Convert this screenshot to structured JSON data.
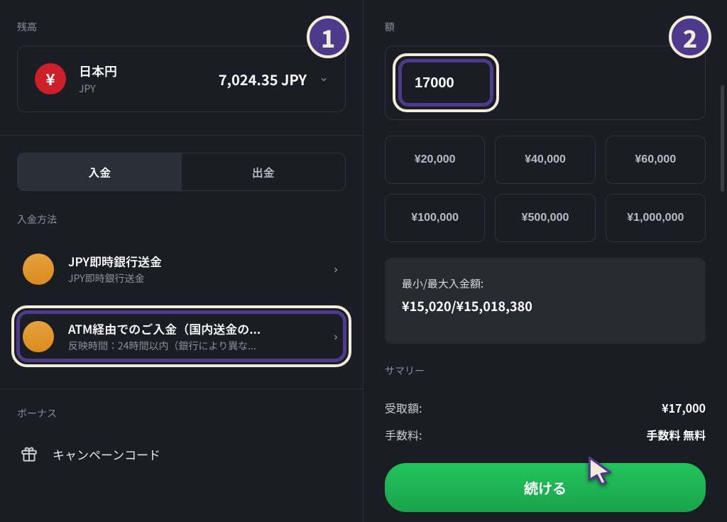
{
  "left": {
    "balance_label": "残高",
    "currency_name": "日本円",
    "currency_code": "JPY",
    "balance_amount": "7,024.35 JPY",
    "tabs": {
      "deposit": "入金",
      "withdraw": "出金"
    },
    "method_label": "入金方法",
    "methods": [
      {
        "title": "JPY即時銀行送金",
        "sub": "JPY即時銀行送金"
      },
      {
        "title": "ATM経由でのご入金（国内送金の...",
        "sub": "反映時間：24時間以内（銀行により異な..."
      }
    ],
    "bonus_label": "ボーナス",
    "bonus_row": "キャンペーンコード"
  },
  "right": {
    "amount_label": "額",
    "amount_value": "17000",
    "presets": [
      "¥20,000",
      "¥40,000",
      "¥60,000",
      "¥100,000",
      "¥500,000",
      "¥1,000,000"
    ],
    "limits_label": "最小/最大入金額:",
    "limits_values": "¥15,020/¥15,018,380",
    "summary_label": "サマリー",
    "receive_label": "受取額:",
    "receive_value": "¥17,000",
    "fee_label": "手数料:",
    "fee_value": "手数料 無料",
    "continue": "続ける"
  },
  "badges": {
    "one": "1",
    "two": "2"
  }
}
